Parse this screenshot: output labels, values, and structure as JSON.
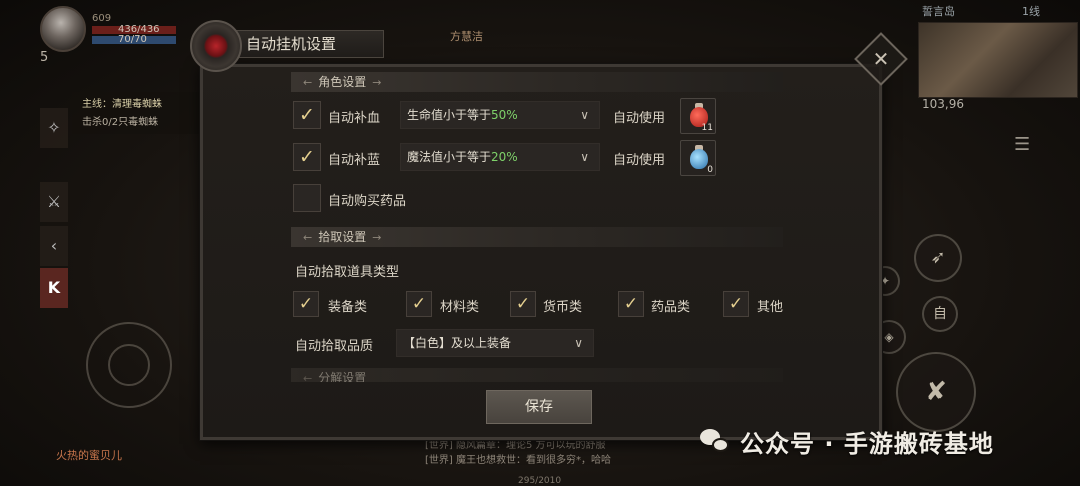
{
  "hud": {
    "level": "5",
    "power": "609",
    "hp": "436/436",
    "mp": "70/70",
    "player_name": "火热的蜜贝儿",
    "target_name": "方慧洁"
  },
  "quest": {
    "title": "主线：清理毒蜘蛛",
    "progress": "击杀0/2只毒蜘蛛"
  },
  "minimap": {
    "map_name": "誓言岛",
    "line": "1线",
    "coords": "103,96"
  },
  "skills": {
    "auto": "自"
  },
  "chat": {
    "line1": "[世界] 隐风篇章：理论5 方可以玩的舒服",
    "line2": "[世界] 魔王也想救世：看到很多穷*，哈哈"
  },
  "exp": "295/2010",
  "watermark": "公众号 · 手游搬砖基地",
  "dialog": {
    "title": "自动挂机设置",
    "close_icon": "✕",
    "role_section": "角色设置",
    "auto_hp_label": "自动补血",
    "auto_hp_condition_prefix": "生命值小于等于",
    "auto_hp_condition_pct": "50%",
    "auto_hp_use": "自动使用",
    "hp_potion_count": "11",
    "auto_mp_label": "自动补蓝",
    "auto_mp_condition_prefix": "魔法值小于等于",
    "auto_mp_condition_pct": "20%",
    "auto_mp_use": "自动使用",
    "mp_potion_count": "0",
    "auto_buy_label": "自动购买药品",
    "pickup_section": "拾取设置",
    "pickup_types_label": "自动拾取道具类型",
    "pickup_equipment": "装备类",
    "pickup_material": "材料类",
    "pickup_currency": "货币类",
    "pickup_medicine": "药品类",
    "pickup_other": "其他",
    "pickup_quality_label": "自动拾取品质",
    "pickup_quality_value": "【白色】及以上装备",
    "decompose_section": "分解设置",
    "save_label": "保存"
  },
  "colors": {
    "accent_green": "#7ed26a",
    "check_gold": "#e4cf8f"
  }
}
